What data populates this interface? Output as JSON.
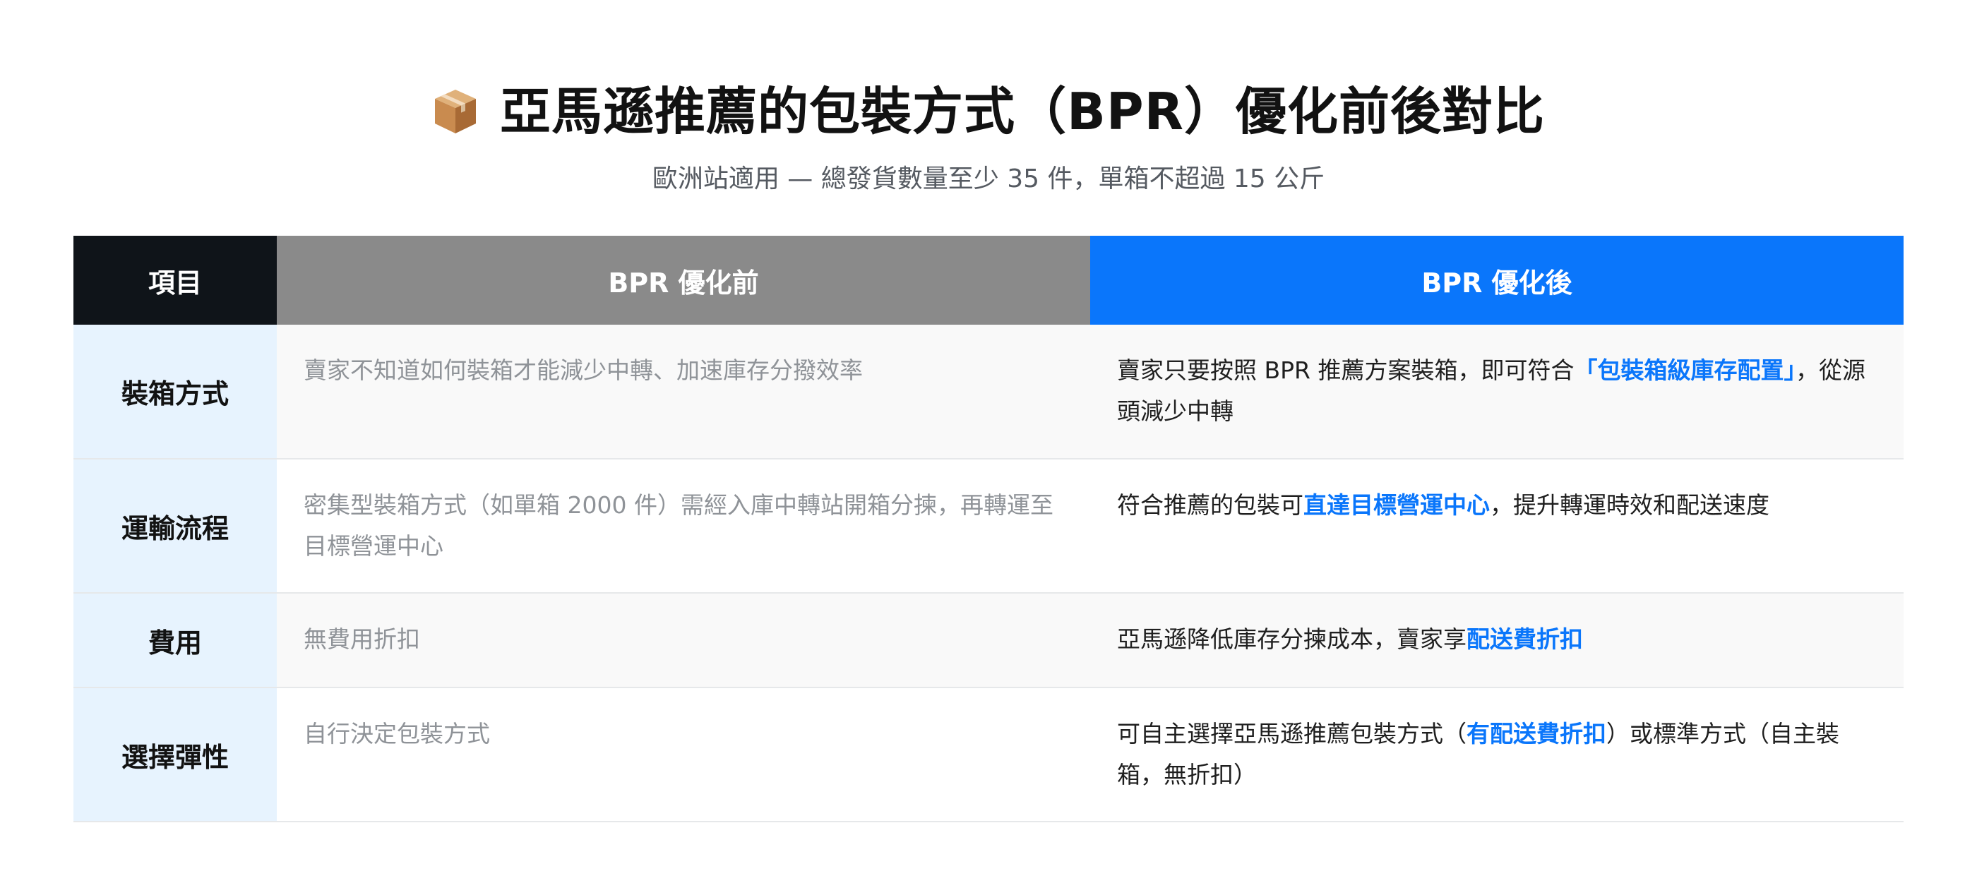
{
  "header": {
    "title": "亞馬遜推薦的包裝方式（BPR）優化前後對比",
    "icon": "package-box-icon",
    "subtitle": "歐洲站適用 — 總發貨數量至少 35 件，單箱不超過 15 公斤"
  },
  "colors": {
    "item_header_bg": "#0f1419",
    "before_header_bg": "#8a8a8a",
    "after_header_bg": "#0a76fb",
    "item_cell_bg": "#e7f3fe",
    "highlight": "#0a76fb"
  },
  "table": {
    "headers": {
      "item": "項目",
      "before": "BPR 優化前",
      "after": "BPR 優化後"
    },
    "rows": [
      {
        "item": "裝箱方式",
        "before": "賣家不知道如何裝箱才能減少中轉、加速庫存分撥效率",
        "after": {
          "pre": "賣家只要按照 BPR 推薦方案裝箱，即可符合",
          "highlight": "「包裝箱級庫存配置」",
          "post": "，從源頭減少中轉"
        }
      },
      {
        "item": "運輸流程",
        "before": "密集型裝箱方式（如單箱 2000 件）需經入庫中轉站開箱分揀，再轉運至目標營運中心",
        "after": {
          "pre": "符合推薦的包裝可",
          "highlight": "直達目標營運中心",
          "post": "，提升轉運時效和配送速度"
        }
      },
      {
        "item": "費用",
        "before": "無費用折扣",
        "after": {
          "pre": "亞馬遜降低庫存分揀成本，賣家享",
          "highlight": "配送費折扣",
          "post": ""
        }
      },
      {
        "item": "選擇彈性",
        "before": "自行決定包裝方式",
        "after": {
          "pre": "可自主選擇亞馬遜推薦包裝方式（",
          "highlight": "有配送費折扣",
          "post": "）或標準方式（自主裝箱，無折扣）"
        }
      }
    ]
  }
}
